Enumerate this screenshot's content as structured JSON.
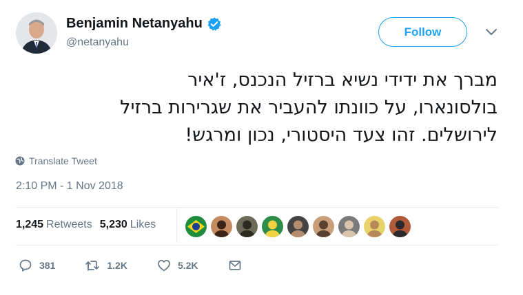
{
  "author": {
    "name": "Benjamin Netanyahu",
    "handle": "@netanyahu",
    "verified_icon": "verified-badge-icon",
    "follow_label": "Follow"
  },
  "tweet": {
    "lines": [
      "מברך את ידידי נשיא ברזיל הנכנס, ז'איר",
      "בולסונארו, על כוונתו להעביר את שגרירות ברזיל",
      "לירושלים. זהו צעד היסטורי, נכון ומרגש!"
    ],
    "translate_label": "Translate Tweet",
    "timestamp": "2:10 PM - 1 Nov 2018"
  },
  "stats": {
    "retweets_count": "1,245",
    "retweets_label": "Retweets",
    "likes_count": "5,230",
    "likes_label": "Likes"
  },
  "likers": [
    {
      "icon": "brazil-flag-avatar",
      "colors": [
        "#1e8e3e",
        "#f9d616"
      ]
    },
    {
      "icon": "user-avatar",
      "colors": [
        "#c48a60",
        "#3b2416"
      ]
    },
    {
      "icon": "user-avatar",
      "colors": [
        "#6d6a58",
        "#2d2a22"
      ]
    },
    {
      "icon": "user-avatar",
      "colors": [
        "#2f8d4a",
        "#f2d343"
      ]
    },
    {
      "icon": "user-avatar",
      "colors": [
        "#444444",
        "#b38d6e"
      ]
    },
    {
      "icon": "user-avatar",
      "colors": [
        "#c99f7a",
        "#5a4030"
      ]
    },
    {
      "icon": "user-avatar",
      "colors": [
        "#7a7a7a",
        "#d9c3ab"
      ]
    },
    {
      "icon": "user-avatar",
      "colors": [
        "#e8d26a",
        "#b58a58"
      ]
    },
    {
      "icon": "user-avatar",
      "colors": [
        "#b05a3a",
        "#2a2a2a"
      ]
    }
  ],
  "actions": {
    "reply_count": "381",
    "retweet_count": "1.2K",
    "like_count": "5.2K"
  },
  "colors": {
    "accent": "#1da1f2",
    "secondary_text": "#657786",
    "divider": "#e6ecf0"
  }
}
